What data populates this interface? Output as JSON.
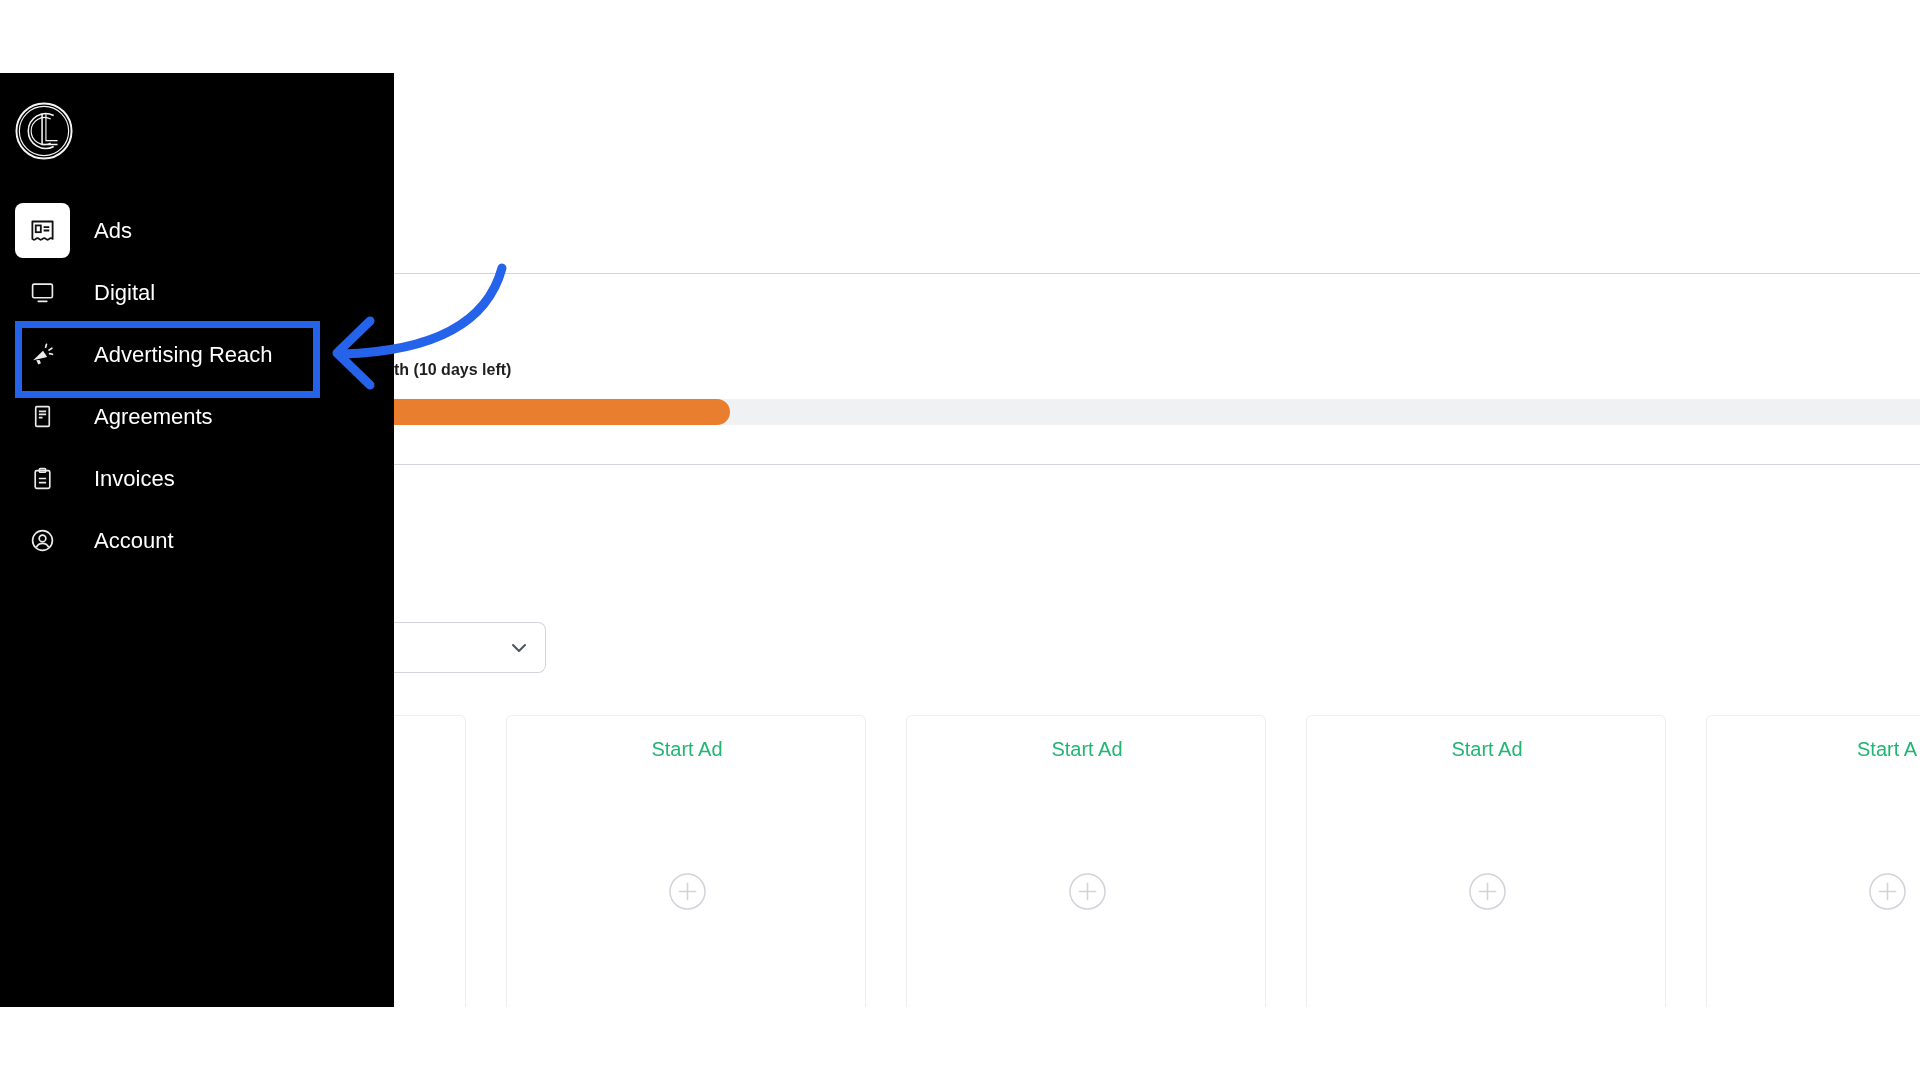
{
  "sidebar": {
    "items": [
      {
        "label": "Ads",
        "selected": true
      },
      {
        "label": "Digital",
        "selected": false
      },
      {
        "label": "Advertising Reach",
        "selected": false
      },
      {
        "label": "Agreements",
        "selected": false
      },
      {
        "label": "Invoices",
        "selected": false
      },
      {
        "label": "Account",
        "selected": false
      }
    ]
  },
  "usage": {
    "caption": "th (10 days left)",
    "level": 0.22
  },
  "cards": [
    {
      "title": "Start Ad"
    },
    {
      "title": "Start Ad"
    },
    {
      "title": "Start Ad"
    },
    {
      "title": "Start A"
    }
  ]
}
